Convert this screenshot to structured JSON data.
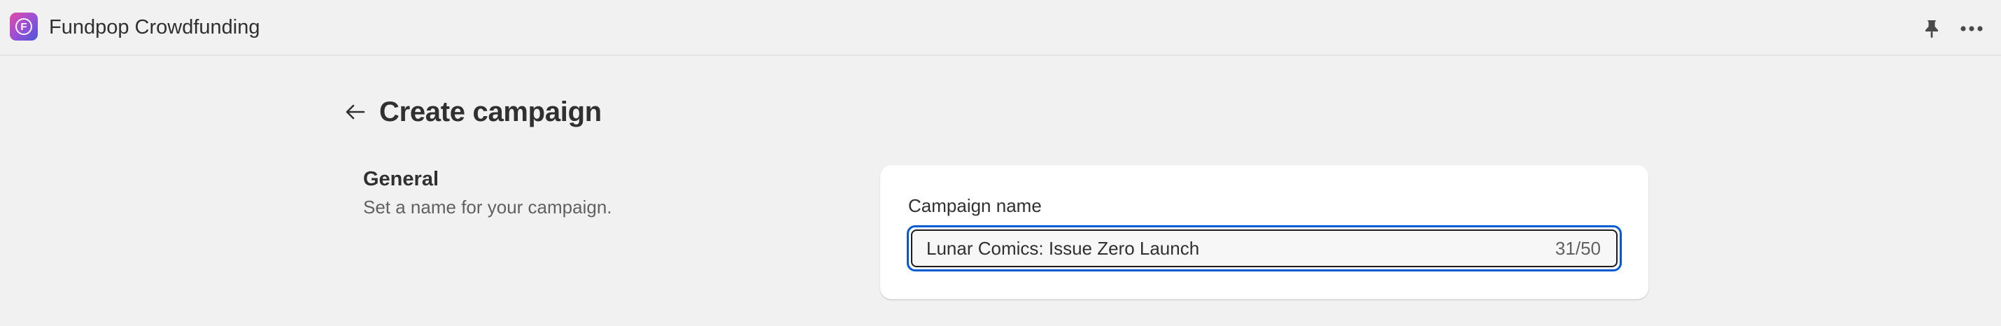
{
  "app": {
    "title": "Fundpop Crowdfunding",
    "logo_letter": "F",
    "logo_icon": "fundpop-logo-icon",
    "pin_icon": "pin-icon",
    "more_icon": "more-horizontal-icon"
  },
  "page": {
    "back_icon": "arrow-left-icon",
    "title": "Create campaign"
  },
  "general": {
    "heading": "General",
    "description": "Set a name for your campaign."
  },
  "campaign_name": {
    "label": "Campaign name",
    "value": "Lunar Comics: Issue Zero Launch",
    "char_count": "31/50"
  },
  "colors": {
    "background": "#f1f1f1",
    "card": "#ffffff",
    "focus_ring": "#005bd3",
    "text_primary": "#303030",
    "text_secondary": "#616161"
  }
}
